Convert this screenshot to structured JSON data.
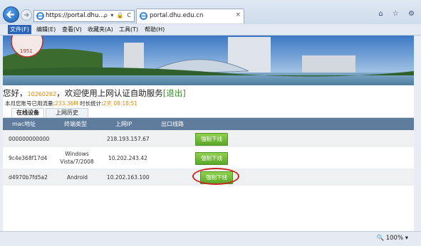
{
  "browser": {
    "address_url": "https://portal.dhu....",
    "address_icons": "ρ ▾ 🔒 C",
    "tab_title": "portal.dhu.edu.cn",
    "tab_close": "×",
    "window_icons": "⌂ ☆ ⚙"
  },
  "menu": {
    "file": "文件(F)",
    "edit": "编辑(E)",
    "view": "查看(V)",
    "favorites": "收藏夹(A)",
    "tools": "工具(T)",
    "help": "帮助(H)"
  },
  "banner": {
    "stamp_text": "1951"
  },
  "greeting": {
    "hello": "您好，",
    "account": "10260262",
    "welcome": "，欢迎使用上网认证自助服务",
    "logout": "[退出]"
  },
  "usage": {
    "label": "本月您账号已用流量:",
    "traffic": "233.36M",
    "time_label": " 时长统计:",
    "time": "2天 08:18:51"
  },
  "tabs": {
    "online": "在线设备",
    "history": "上网历史"
  },
  "table": {
    "headers": [
      "mac地址",
      "终端类型",
      "上网IP",
      "出口线路"
    ],
    "rows": [
      {
        "mac": "000000000000",
        "type": "",
        "ip": "218.193.157.67",
        "button": "强制下线"
      },
      {
        "mac": "9c4e368f17d4",
        "type": "Windows Vista/7/2008",
        "ip": "10.202.243.42",
        "button": "强制下线"
      },
      {
        "mac": "d4970b7fd5a2",
        "type": "Android",
        "ip": "10.202.163.100",
        "button": "强制下线"
      }
    ]
  },
  "status": {
    "zoom": "🔍 100%  ▾"
  },
  "colors": {
    "table_header": "#5f7c9c",
    "button_green": "#6fb83a",
    "accent_orange": "#e08a00",
    "highlight_red": "#c8281f"
  }
}
